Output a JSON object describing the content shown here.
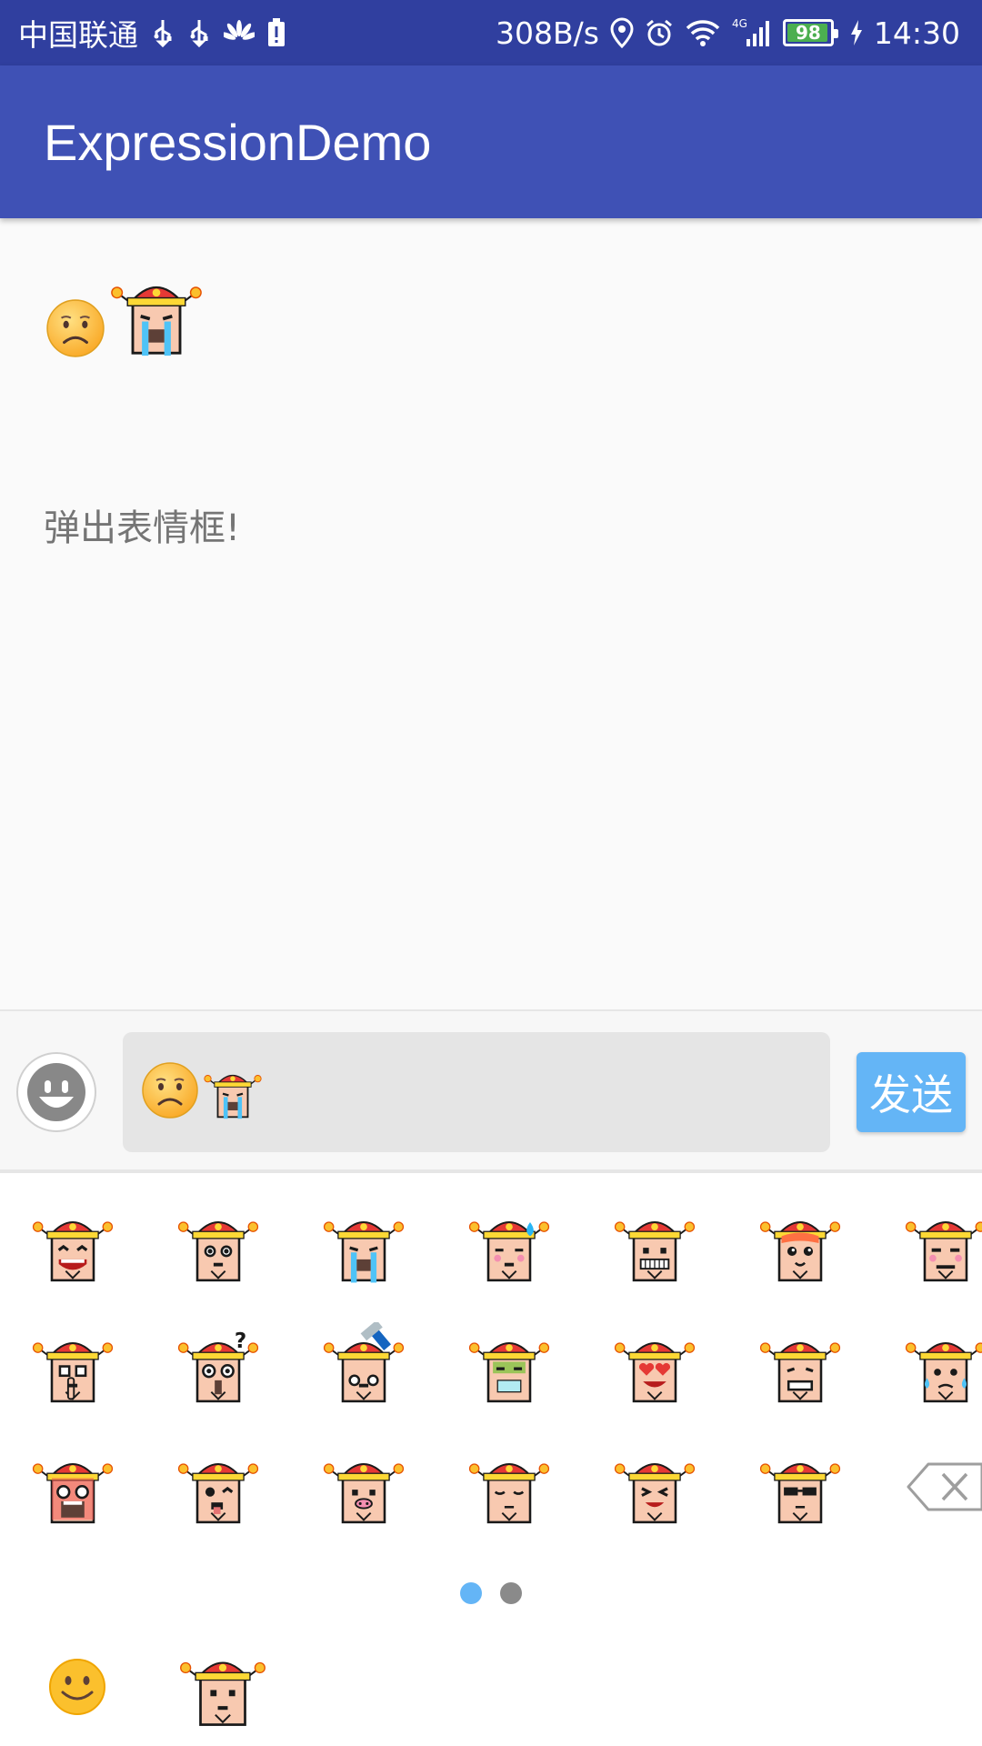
{
  "status_bar": {
    "carrier": "中国联通",
    "net_speed": "308B/s",
    "network_type": "4G",
    "battery": "98",
    "time": "14:30",
    "icons": [
      "usb-icon",
      "usb-icon",
      "huawei-icon",
      "battery-alert-icon",
      "location-icon",
      "alarm-icon",
      "wifi-icon",
      "signal-icon",
      "battery-icon",
      "charging-icon"
    ]
  },
  "app_bar": {
    "title": "ExpressionDemo"
  },
  "content": {
    "display_emojis": [
      "sad-face-emoji",
      "crying-god-emoji"
    ],
    "hint": "弹出表情框!"
  },
  "input_bar": {
    "field_emojis": [
      "sad-face-emoji",
      "crying-god-emoji"
    ],
    "send_label": "发送"
  },
  "emoji_panel": {
    "emojis": [
      "laughing-god-emoji",
      "surprised-god-emoji",
      "crying-god-emoji",
      "sweat-drop-god-emoji",
      "grinning-god-emoji",
      "cute-god-emoji",
      "sly-god-emoji",
      "shh-god-emoji",
      "question-god-emoji",
      "hammer-god-emoji",
      "sick-god-emoji",
      "heart-eyes-god-emoji",
      "grimace-god-emoji",
      "tearful-god-emoji",
      "angry-god-emoji",
      "wink-tongue-god-emoji",
      "pig-nose-god-emoji",
      "sleepy-god-emoji",
      "squint-god-emoji",
      "sunglasses-god-emoji"
    ],
    "delete_icon": "backspace-icon",
    "pages": 2,
    "active_page": 1,
    "tabs": [
      "smiley-tab-icon",
      "god-tab-icon"
    ]
  },
  "colors": {
    "status_bar": "#303f9f",
    "app_bar": "#3f51b5",
    "send_button": "#64b5f6",
    "dot_active": "#64b5f6",
    "dot_inactive": "#8a8a8a",
    "hat_red": "#e53935",
    "face": "#f8c9b0"
  }
}
